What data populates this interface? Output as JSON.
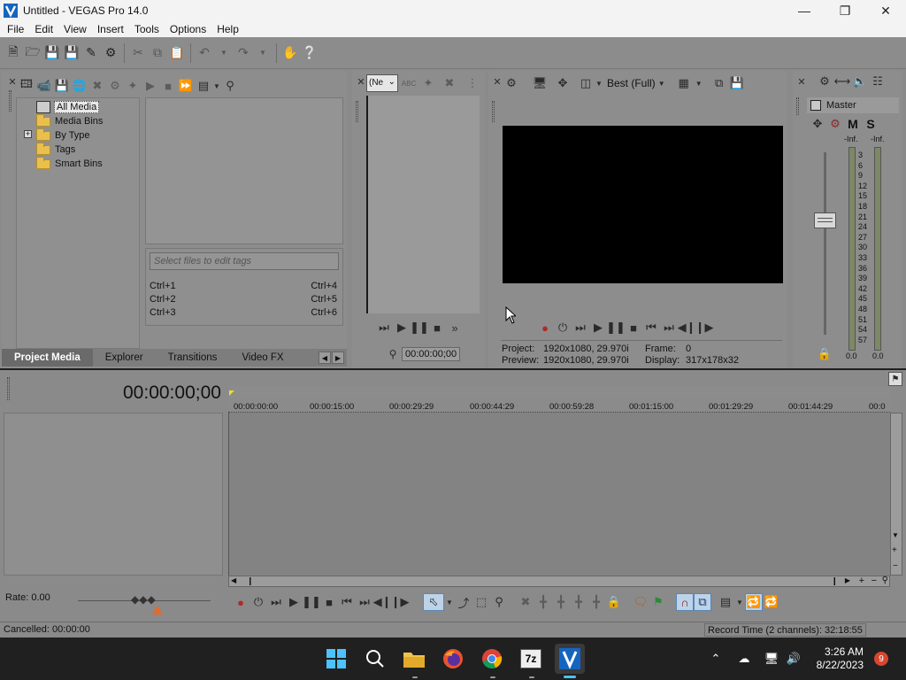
{
  "window": {
    "title": "Untitled - VEGAS Pro 14.0",
    "minimize_icon": "minimize-icon",
    "maximize_icon": "maximize-icon",
    "close_icon": "close-icon"
  },
  "menu": [
    "File",
    "Edit",
    "View",
    "Insert",
    "Tools",
    "Options",
    "Help"
  ],
  "project_media": {
    "tree": [
      {
        "label": "All Media",
        "selected": true
      },
      {
        "label": "Media Bins"
      },
      {
        "label": "By Type",
        "expandable": true,
        "expander": "+"
      },
      {
        "label": "Tags"
      },
      {
        "label": "Smart Bins"
      }
    ],
    "tag_placeholder": "Select files to edit tags",
    "shortcuts": [
      {
        "left": "Ctrl+1",
        "right": "Ctrl+4"
      },
      {
        "left": "Ctrl+2",
        "right": "Ctrl+5"
      },
      {
        "left": "Ctrl+3",
        "right": "Ctrl+6"
      }
    ]
  },
  "tabs": [
    "Project Media",
    "Explorer",
    "Transitions",
    "Video FX"
  ],
  "trimmer": {
    "dropdown_value": "(Ne",
    "timecode": "00:00:00;00"
  },
  "preview": {
    "quality": "Best (Full)",
    "project_label": "Project:",
    "project_value": "1920x1080, 29.970i",
    "preview_label": "Preview:",
    "preview_value": "1920x1080, 29.970i",
    "frame_label": "Frame:",
    "frame_value": "0",
    "display_label": "Display:",
    "display_value": "317x178x32"
  },
  "master": {
    "title": "Master",
    "mute_label": "M",
    "solo_label": "S",
    "peak_left": "-Inf.",
    "peak_right": "-Inf.",
    "scale": [
      "3",
      "6",
      "9",
      "12",
      "15",
      "18",
      "21",
      "24",
      "27",
      "30",
      "33",
      "36",
      "39",
      "42",
      "45",
      "48",
      "51",
      "54",
      "57"
    ],
    "level_left": "0.0",
    "level_right": "0.0"
  },
  "timeline": {
    "timecode": "00:00:00;00",
    "ruler": [
      "00:00:00:00",
      "00:00:15:00",
      "00:00:29:29",
      "00:00:44:29",
      "00:00:59:28",
      "00:01:15:00",
      "00:01:29:29",
      "00:01:44:29",
      "00:0"
    ],
    "rate": "Rate: 0.00"
  },
  "status": {
    "left": "Cancelled: 00:00:00",
    "right": "Record Time (2 channels): 32:18:55"
  },
  "taskbar": {
    "time": "3:26 AM",
    "date": "8/22/2023",
    "notifications": "9",
    "zip_label": "7z"
  },
  "colors": {
    "titlebar": "#f3f3f3",
    "panel": "#8d8d8d",
    "taskbar": "#202020",
    "accent_blue": "#0078d4",
    "video_bg": "#000000"
  }
}
